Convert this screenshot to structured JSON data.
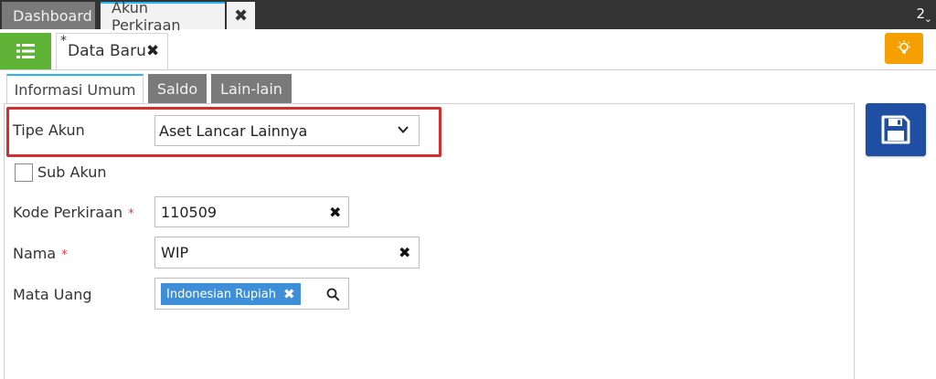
{
  "tabs": {
    "dashboard_label": "Dashboard",
    "active_label": "Akun Perkiraan",
    "close_symbol": "✖",
    "count": "2"
  },
  "subtab": {
    "modified_mark": "*",
    "label": "Data Baru",
    "close_symbol": "✖"
  },
  "section_tabs": [
    "Informasi Umum",
    "Saldo",
    "Lain-lain"
  ],
  "form": {
    "tipe_akun": {
      "label": "Tipe Akun",
      "value": "Aset Lancar Lainnya"
    },
    "sub_akun": {
      "label": "Sub Akun",
      "checked": false
    },
    "kode_perkiraan": {
      "label": "Kode Perkiraan",
      "required_mark": "*",
      "value": "110509"
    },
    "nama": {
      "label": "Nama",
      "required_mark": "*",
      "value": "WIP"
    },
    "mata_uang": {
      "label": "Mata Uang",
      "chip": "Indonesian Rupiah"
    }
  },
  "icons": {
    "list": "list-icon",
    "bulb": "lightbulb-icon",
    "save": "save-icon",
    "search": "search-icon",
    "chevron": "chevron-down-icon"
  },
  "colors": {
    "accent_green": "#5fb337",
    "accent_orange": "#f5a000",
    "save_blue": "#1e4fa3",
    "chip_blue": "#3f8fd8",
    "highlight_red": "#d32f2f",
    "tab_active_border": "#29b6f6"
  }
}
